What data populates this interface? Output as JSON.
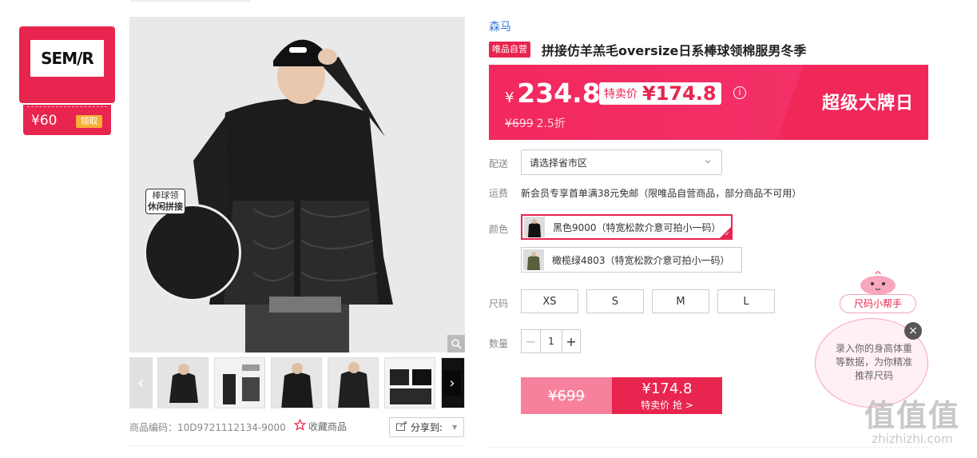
{
  "brand_card": {
    "logo_text": "SEM/R",
    "coupon_amount": "¥60",
    "coupon_button": "领取"
  },
  "gallery": {
    "inset_label_line1": "棒球领",
    "inset_label_line2": "休闲拼接",
    "thumb_prev": "‹",
    "thumb_next": "›"
  },
  "meta": {
    "sku_code": "商品编码：10D9721112134-9000",
    "favorite_label": "收藏商品",
    "share_label": "分享到:"
  },
  "product": {
    "brand": "森马",
    "self_badge": "唯品自营",
    "title": "拼接仿羊羔毛oversize日系棒球领棉服男冬季"
  },
  "price": {
    "currency": "¥",
    "current": "234.8",
    "flash_label": "特卖价",
    "flash_price": "¥174.8",
    "original": "¥699",
    "discount": "2.5折",
    "campaign": "超级大牌日",
    "info_icon": "i"
  },
  "delivery": {
    "label": "配送",
    "placeholder": "请选择省市区"
  },
  "freight": {
    "label": "运费",
    "text": "新会员专享首单满38元免邮（限唯品自营商品，部分商品不可用）"
  },
  "colors": {
    "label": "颜色",
    "options": [
      {
        "name": "黑色9000（特宽松款介意可拍小一码）",
        "selected": true
      },
      {
        "name": "橄榄绿4803（特宽松款介意可拍小一码）",
        "selected": false
      }
    ]
  },
  "sizes": {
    "label": "尺码",
    "options": [
      "XS",
      "S",
      "M",
      "L"
    ]
  },
  "quantity": {
    "label": "数量",
    "value": "1",
    "minus": "−",
    "plus": "+"
  },
  "buy": {
    "original_price": "¥699",
    "flash_price": "¥174.8",
    "flash_action": "特卖价 抢 >"
  },
  "size_helper": {
    "label": "尺码小帮手",
    "text": "录入你的身高体重等数据，为你精准推荐尺码",
    "close": "×"
  },
  "watermark": {
    "big": "值值值",
    "small": "zhizhizhi.com"
  },
  "colors_theme": {
    "accent": "#e8254f",
    "coupon_button": "#f6b033",
    "brand_link": "#3a7bd5"
  }
}
